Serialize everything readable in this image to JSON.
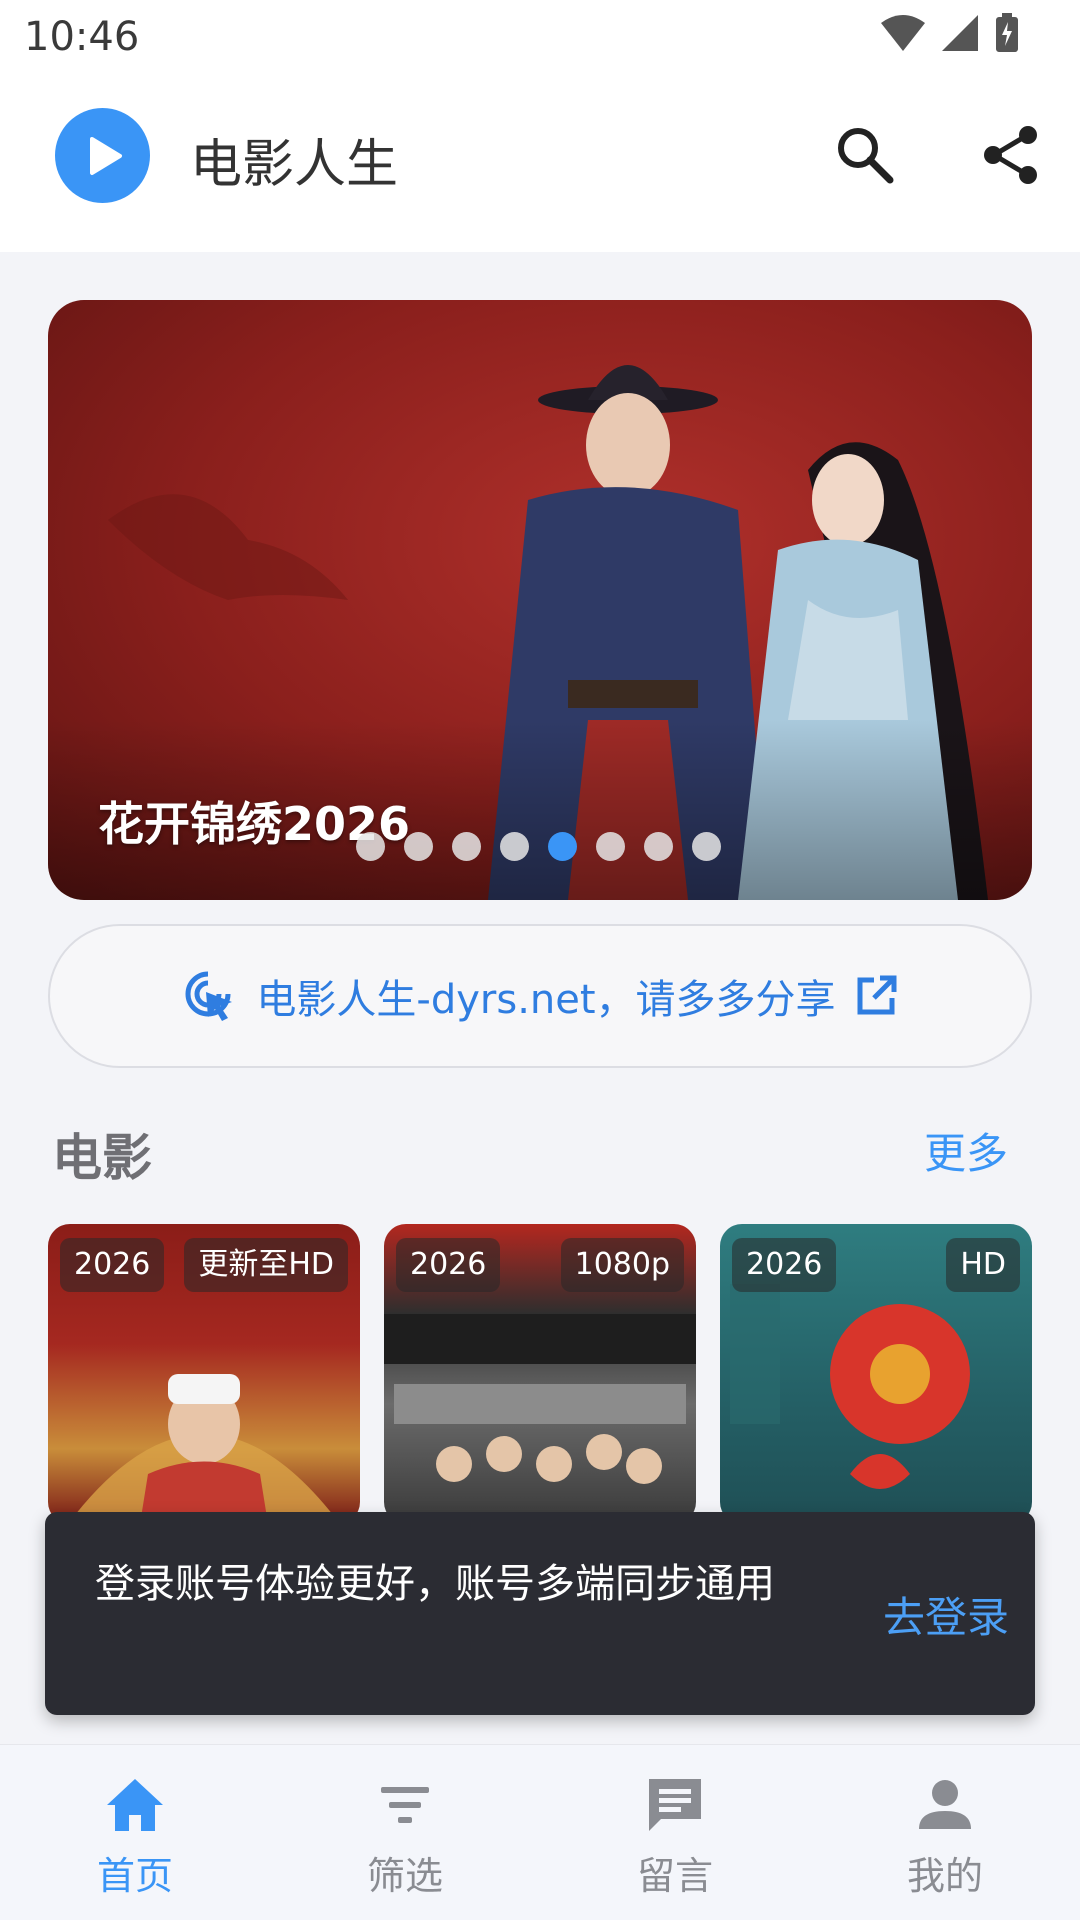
{
  "status_bar": {
    "time": "10:46",
    "icons": [
      "wifi-icon",
      "signal-icon",
      "battery-charging-icon"
    ]
  },
  "app_bar": {
    "title": "电影人生",
    "logo_icon": "play-icon",
    "actions": [
      "search-icon",
      "share-icon"
    ],
    "accent_color": "#3a95f6"
  },
  "banner": {
    "title": "花开锦绣2026",
    "dots_total": 8,
    "active_index": 4
  },
  "share_pill": {
    "text": "电影人生-dyrs.net，请多多分享",
    "leading_icon": "click-cursor-icon",
    "trailing_icon": "open-external-icon"
  },
  "movies_section": {
    "title": "电影",
    "more_label": "更多",
    "items": [
      {
        "year": "2026",
        "quality": "更新至HD"
      },
      {
        "year": "2026",
        "quality": "1080p"
      },
      {
        "year": "2026",
        "quality": "HD"
      }
    ]
  },
  "snackbar": {
    "message": "登录账号体验更好，账号多端同步通用",
    "action": "去登录"
  },
  "bottom_nav": {
    "items": [
      {
        "label": "首页",
        "icon": "home-icon",
        "active": true
      },
      {
        "label": "筛选",
        "icon": "filter-icon",
        "active": false
      },
      {
        "label": "留言",
        "icon": "message-icon",
        "active": false
      },
      {
        "label": "我的",
        "icon": "person-icon",
        "active": false
      }
    ]
  }
}
